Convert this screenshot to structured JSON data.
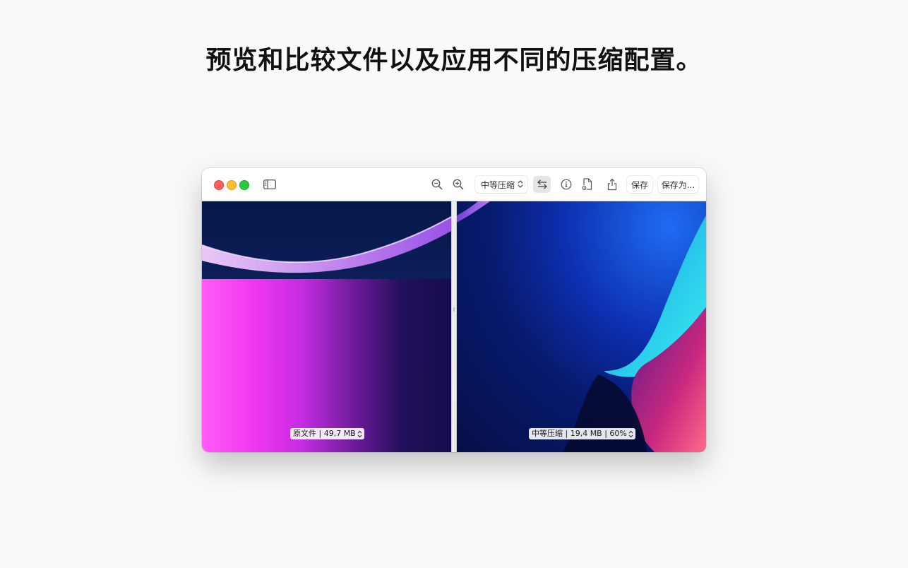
{
  "headline": "预览和比较文件以及应用不同的压缩配置。",
  "toolbar": {
    "icons": {
      "sidebar": "sidebar-toggle-icon",
      "zoom_out": "zoom-out-icon",
      "zoom_in": "zoom-in-icon",
      "swap": "swap-arrows-icon",
      "info": "info-icon",
      "document": "document-settings-icon",
      "share": "share-icon"
    },
    "preset_select": "中等压缩",
    "save_label": "保存",
    "save_as_label": "保存为..."
  },
  "panes": {
    "left_label": "原文件 | 49,7 MB",
    "right_label": "中等压缩 | 19,4 MB | 60%"
  },
  "colors": {
    "close": "#fe5f57",
    "minimize": "#febc2e",
    "maximize": "#28c840"
  }
}
